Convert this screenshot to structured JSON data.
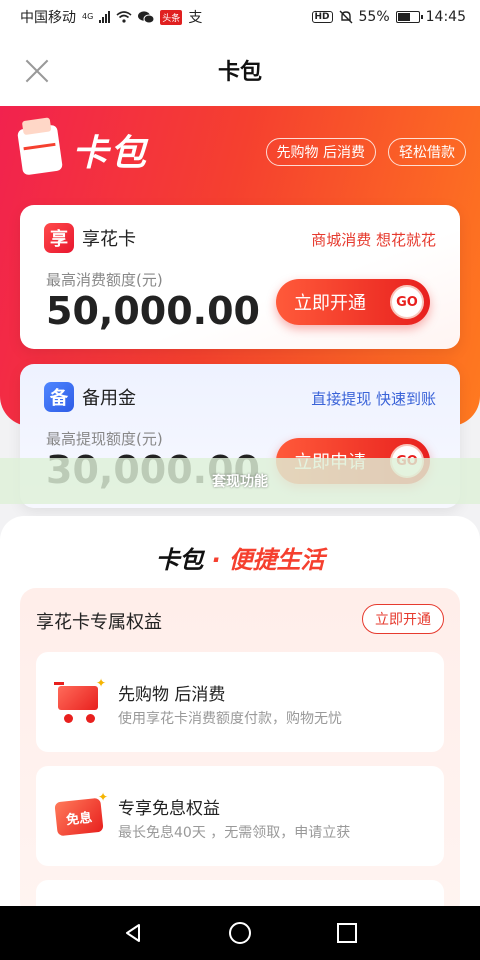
{
  "status_bar": {
    "carrier": "中国移动",
    "net": "4G",
    "app_badge": "头条",
    "extra_icon": "支",
    "hd": "HD",
    "battery": "55%",
    "time": "14:45"
  },
  "header": {
    "title": "卡包"
  },
  "hero": {
    "logo_text": "卡包",
    "tags": [
      "先购物 后消费",
      "轻松借款"
    ]
  },
  "cards": [
    {
      "icon_char": "享",
      "name": "享花卡",
      "slogan": "商城消费 想花就花",
      "sub_label": "最高消费额度(元)",
      "amount": "50,000.00",
      "button_label": "立即开通",
      "go": "GO"
    },
    {
      "icon_char": "备",
      "name": "备用金",
      "slogan": "直接提现 快速到账",
      "sub_label": "最高提现额度(元)",
      "amount": "30,000.00",
      "button_label": "立即申请",
      "go": "GO"
    }
  ],
  "overlay": {
    "text": "套现功能"
  },
  "section": {
    "title_part1": "卡包",
    "dot": "·",
    "title_part2": "便捷生活"
  },
  "benefits": {
    "title": "享花卡专属权益",
    "button_label": "立即开通",
    "items": [
      {
        "icon": "shopping-cart-icon",
        "title": "先购物 后消费",
        "desc": "使用享花卡消费额度付款，购物无忧"
      },
      {
        "icon": "interest-free-icon",
        "icon_text": "免息",
        "title": "专享免息权益",
        "desc": "最长免息40天 ，无需领取，申请立获"
      }
    ]
  }
}
